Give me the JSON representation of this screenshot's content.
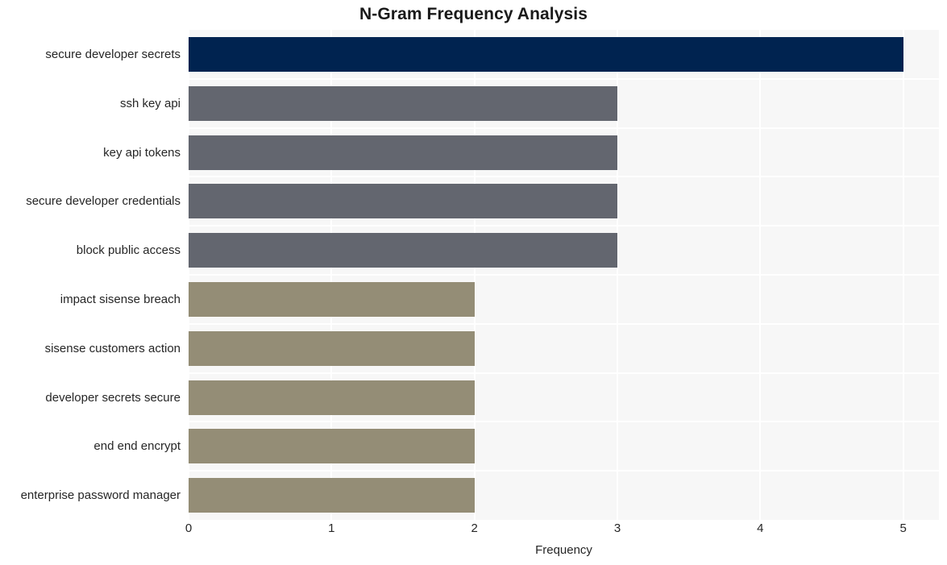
{
  "chart_data": {
    "type": "bar",
    "orientation": "horizontal",
    "title": "N-Gram Frequency Analysis",
    "xlabel": "Frequency",
    "ylabel": "",
    "xlim": [
      0,
      5.25
    ],
    "xticks": [
      0,
      1,
      2,
      3,
      4,
      5
    ],
    "xtick_labels": [
      "0",
      "1",
      "2",
      "3",
      "4",
      "5"
    ],
    "grid": true,
    "legend": "none",
    "categories": [
      "secure developer secrets",
      "ssh key api",
      "key api tokens",
      "secure developer credentials",
      "block public access",
      "impact sisense breach",
      "sisense customers action",
      "developer secrets secure",
      "end end encrypt",
      "enterprise password manager"
    ],
    "values": [
      5,
      3,
      3,
      3,
      3,
      2,
      2,
      2,
      2,
      2
    ],
    "bar_colors": [
      "#002350",
      "#63666f",
      "#63666f",
      "#63666f",
      "#63666f",
      "#948d76",
      "#948d76",
      "#948d76",
      "#948d76",
      "#948d76"
    ]
  },
  "style": {
    "plot_background": "#f7f7f7",
    "figure_background": "#ffffff",
    "gridline_color": "#ffffff",
    "text_color": "#262626",
    "title_color": "#1a1a1a"
  }
}
